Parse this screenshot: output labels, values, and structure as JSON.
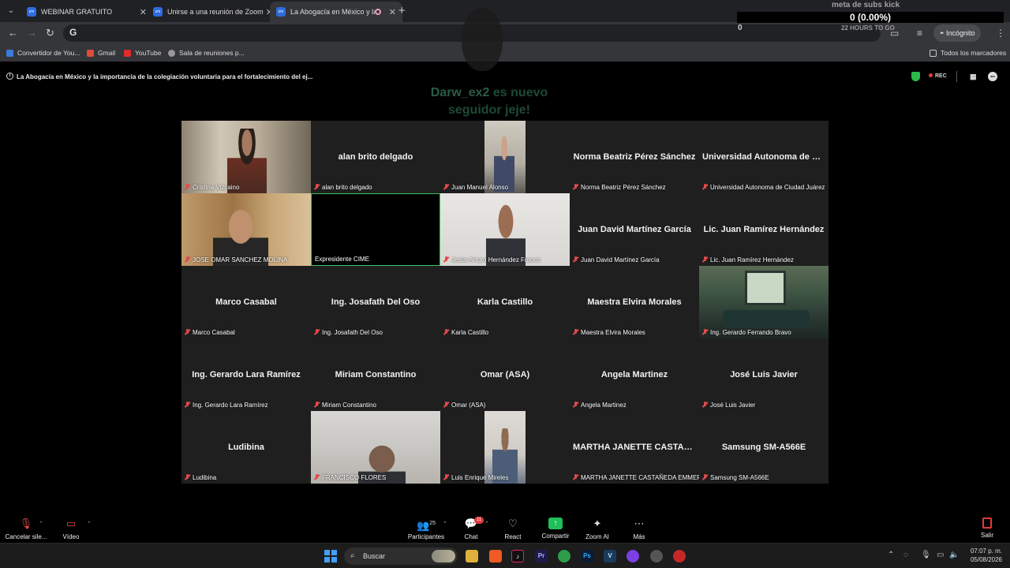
{
  "browser": {
    "tabs": [
      {
        "label": "WEBINAR GRATUITO",
        "favicon": "zm"
      },
      {
        "label": "Unirse a una reunión de Zoom",
        "favicon": "zm"
      },
      {
        "label": "La Abogacía en México y la",
        "favicon": "zm",
        "active": true
      }
    ],
    "omnibox_prefix": "G",
    "incognito_label": "Incógnito",
    "bookmarks": [
      {
        "label": "Convertidor de You...",
        "color": "#3b7be0"
      },
      {
        "label": "Gmail",
        "color": "#e04b3b"
      },
      {
        "label": "YouTube",
        "color": "#e02b2b"
      },
      {
        "label": "Sala de reuniones p...",
        "color": "#999999"
      }
    ],
    "all_bookmarks_label": "Todos los marcadores"
  },
  "stream_overlay": {
    "goal_title": "meta de subs kick",
    "goal_value": "0 (0.00%)",
    "goal_start": "0",
    "goal_time": "22 HOURS TO GO",
    "follower_name": "Darw_ex2",
    "follower_text": "es nuevo seguidor jeje!"
  },
  "meeting": {
    "title": "La Abogacía en México y la importancia de la colegiación voluntaria para el fortalecimiento del ej...",
    "rec_label": "REC",
    "accent_color": "#34c759"
  },
  "participants": [
    {
      "name": "Cristina Vizcaino",
      "center": "",
      "video": "cristina",
      "muted": true
    },
    {
      "name": "alan brito delgado",
      "center": "alan brito delgado",
      "video": "",
      "muted": true
    },
    {
      "name": "Juan Manuel Alonso",
      "center": "",
      "video": "juan",
      "muted": true
    },
    {
      "name": "Norma Beatriz Pérez Sánchez",
      "center": "Norma Beatriz Pérez Sánchez",
      "video": "",
      "muted": true
    },
    {
      "name": "Universidad Autonoma de Ciudad Juárez",
      "center": "Universidad Autonoma de C...",
      "video": "",
      "muted": true
    },
    {
      "name": "JOSE OMAR SANCHEZ MOLINA",
      "center": "",
      "video": "omar",
      "muted": true
    },
    {
      "name": "Expresidente CIME",
      "center": "",
      "video": "",
      "muted": false,
      "active": true
    },
    {
      "name": "Jesús Arturo Hernández Franco",
      "center": "",
      "video": "jesus",
      "muted": true
    },
    {
      "name": "Juan David Martínez García",
      "center": "Juan David Martínez García",
      "video": "",
      "muted": true
    },
    {
      "name": "Lic. Juan Ramírez Hernández",
      "center": "Lic. Juan Ramírez Hernández",
      "video": "",
      "muted": true
    },
    {
      "name": "Marco Casabal",
      "center": "Marco Casabal",
      "video": "",
      "muted": true
    },
    {
      "name": "Ing. Josafath Del Oso",
      "center": "Ing. Josafath Del Oso",
      "video": "",
      "muted": true
    },
    {
      "name": "Karla Castillo",
      "center": "Karla Castillo",
      "video": "",
      "muted": true
    },
    {
      "name": "Maestra Elvira Morales",
      "center": "Maestra Elvira Morales",
      "video": "",
      "muted": true
    },
    {
      "name": "Ing. Gerardo Ferrando Bravo",
      "center": "",
      "video": "room",
      "muted": true
    },
    {
      "name": "Ing. Gerardo Lara Ramírez",
      "center": "Ing. Gerardo Lara Ramírez",
      "video": "",
      "muted": true
    },
    {
      "name": "Miriam Constantino",
      "center": "Miriam Constantino",
      "video": "",
      "muted": true
    },
    {
      "name": "Omar (ASA)",
      "center": "Omar (ASA)",
      "video": "",
      "muted": true
    },
    {
      "name": "Angela Martinez",
      "center": "Angela Martinez",
      "video": "",
      "muted": true
    },
    {
      "name": "José Luis Javier",
      "center": "José Luis Javier",
      "video": "",
      "muted": true
    },
    {
      "name": "Ludibina",
      "center": "Ludibina",
      "video": "",
      "muted": true
    },
    {
      "name": "FRANCISCO FLORES",
      "center": "",
      "video": "francisco",
      "muted": true
    },
    {
      "name": "Luis Enrique Mireles",
      "center": "",
      "video": "luis",
      "muted": true
    },
    {
      "name": "MARTHA JANETTE CASTAÑEDA EMMERT",
      "center": "MARTHA JANETTE CASTAÑ...",
      "video": "",
      "muted": true
    },
    {
      "name": "Samsung SM-A566E",
      "center": "Samsung SM-A566E",
      "video": "",
      "muted": true
    }
  ],
  "controls": {
    "mute_label": "Cancelar sile...",
    "video_label": "Vídeo",
    "participants_label": "Participantes",
    "participants_count": "25",
    "chat_label": "Chat",
    "chat_badge": "11",
    "react_label": "React",
    "share_label": "Compartir",
    "ai_label": "Zoom AI",
    "more_label": "Más",
    "leave_label": "Salir"
  },
  "taskbar": {
    "search_label": "Buscar",
    "time": "07:07 p. m.",
    "date": "05/08/2026"
  }
}
